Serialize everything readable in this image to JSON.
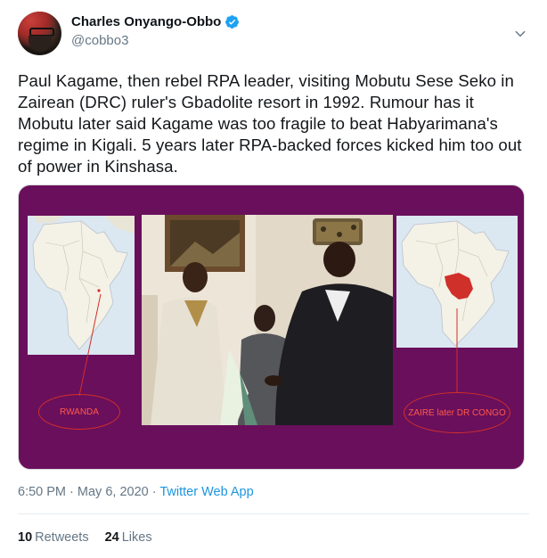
{
  "author": {
    "display_name": "Charles Onyango-Obbo",
    "handle": "@cobbo3",
    "verified": true
  },
  "tweet": {
    "text": "Paul Kagame, then rebel RPA leader, visiting Mobutu Sese Seko in\nZairean (DRC) ruler's Gbadolite resort in 1992. Rumour has it\nMobutu later said Kagame was too fragile to beat Habyarimana's\nregime in Kigali. 5 years later RPA-backed forces kicked him too out\nof power in Kinshasa."
  },
  "media": {
    "left_label": "RWANDA",
    "right_label": "ZAIRE later DR CONGO",
    "background_color": "#6a0f5b",
    "highlight_color": "#d0302a"
  },
  "meta": {
    "time": "6:50 PM",
    "date": "May 6, 2020",
    "separator": "·",
    "source": "Twitter Web App"
  },
  "stats": {
    "retweets_count": "10",
    "retweets_label": "Retweets",
    "likes_count": "24",
    "likes_label": "Likes"
  },
  "icons": {
    "verified": "verified-badge-icon",
    "more": "chevron-down-icon"
  }
}
